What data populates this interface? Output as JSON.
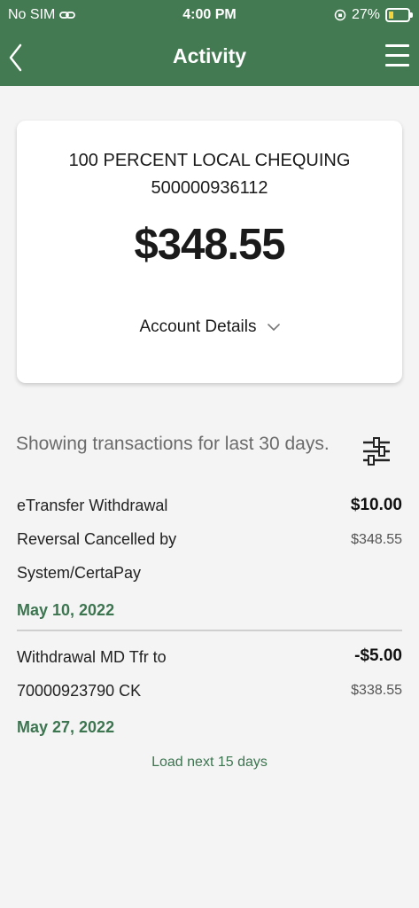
{
  "status_bar": {
    "carrier": "No SIM",
    "time": "4:00 PM",
    "battery": "27%",
    "battery_level": 0.27
  },
  "header": {
    "title": "Activity"
  },
  "account": {
    "name": "100 PERCENT LOCAL CHEQUING",
    "number": "500000936112",
    "balance": "$348.55",
    "details_label": "Account Details"
  },
  "transactions_header": {
    "showing_text": "Showing transactions for last 30 days."
  },
  "transactions": [
    {
      "lines": [
        "eTransfer Withdrawal",
        "Reversal Cancelled by",
        "System/CertaPay"
      ],
      "amount": "$10.00",
      "running_balance": "$348.55",
      "date": "May 10, 2022"
    },
    {
      "lines": [
        "Withdrawal MD Tfr to",
        "70000923790 CK"
      ],
      "amount": "-$5.00",
      "running_balance": "$338.55",
      "date": "May 27, 2022"
    }
  ],
  "load_next_label": "Load next 15 days",
  "colors": {
    "brand_green": "#437a52",
    "date_green": "#3c7550",
    "background": "#f4f4f4"
  }
}
